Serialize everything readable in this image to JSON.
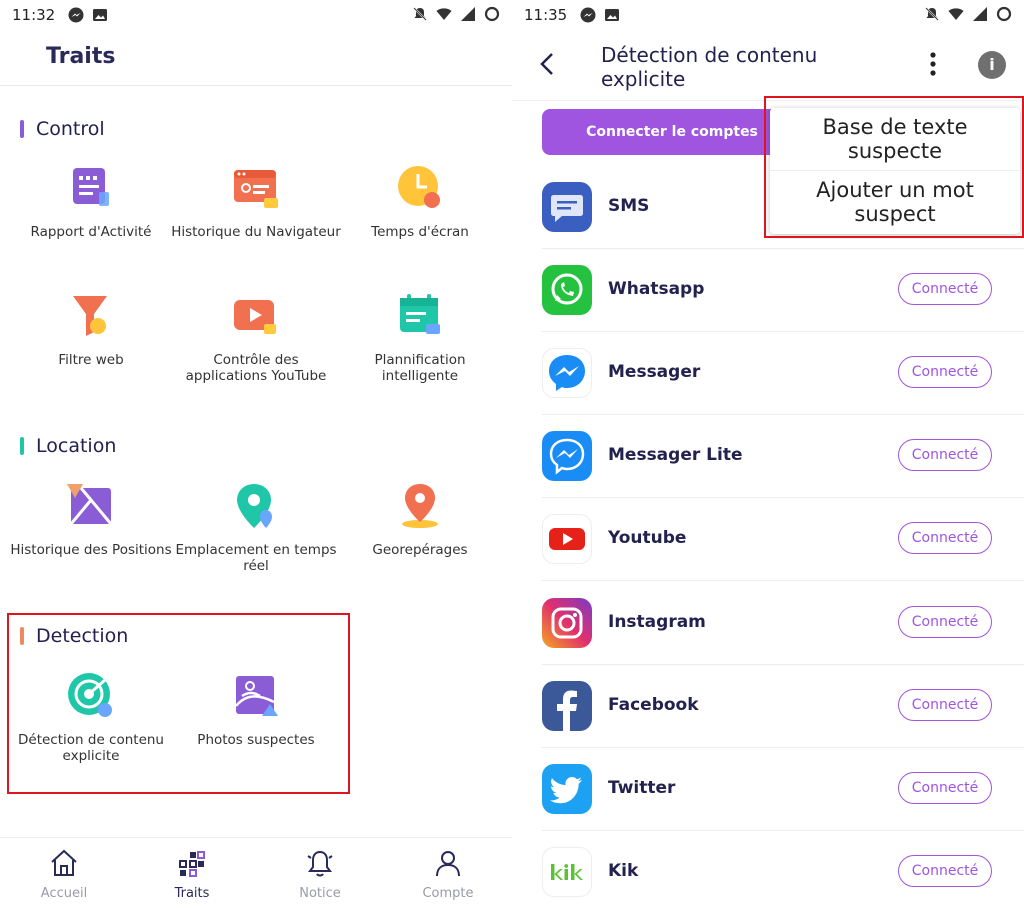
{
  "left": {
    "status_time": "11:32",
    "title": "Traits",
    "sections": [
      {
        "title": "Control",
        "color": "#8a5cd6"
      },
      {
        "title": "Location",
        "color": "#1fc7a8"
      },
      {
        "title": "Detection",
        "color": "#f08a5d"
      }
    ],
    "tiles": [
      {
        "label": "Rapport d'Activité",
        "icon": "activity-report-icon"
      },
      {
        "label": "Historique du Navigateur",
        "icon": "browser-history-icon"
      },
      {
        "label": "Temps d'écran",
        "icon": "screen-time-icon"
      },
      {
        "label": "Filtre web",
        "icon": "web-filter-icon"
      },
      {
        "label": "Contrôle des applications YouTube",
        "icon": "youtube-control-icon"
      },
      {
        "label": "Plannification intelligente",
        "icon": "smart-schedule-icon"
      },
      {
        "label": "Historique des Positions",
        "icon": "location-history-icon"
      },
      {
        "label": "Emplacement en temps réel",
        "icon": "realtime-location-icon"
      },
      {
        "label": "Georepérages",
        "icon": "geofence-icon"
      },
      {
        "label": "Détection de contenu explicite",
        "icon": "explicit-content-icon"
      },
      {
        "label": "Photos suspectes",
        "icon": "suspicious-photos-icon"
      }
    ],
    "nav": [
      {
        "label": "Accueil",
        "icon": "home-icon"
      },
      {
        "label": "Traits",
        "icon": "features-icon"
      },
      {
        "label": "Notice",
        "icon": "bell-icon"
      },
      {
        "label": "Compte",
        "icon": "account-icon"
      }
    ]
  },
  "right": {
    "status_time": "11:35",
    "title": "Détection de contenu explicite",
    "connect_all_label": "Connecter le comptes",
    "menu": [
      "Base de texte suspecte",
      "Ajouter un mot suspect"
    ],
    "apps": [
      {
        "name": "SMS",
        "icon": "sms-icon",
        "status": ""
      },
      {
        "name": "Whatsapp",
        "icon": "whatsapp-icon",
        "status": "Connecté"
      },
      {
        "name": "Messager",
        "icon": "messenger-icon",
        "status": "Connecté"
      },
      {
        "name": "Messager Lite",
        "icon": "messenger-lite-icon",
        "status": "Connecté"
      },
      {
        "name": "Youtube",
        "icon": "youtube-icon",
        "status": "Connecté"
      },
      {
        "name": "Instagram",
        "icon": "instagram-icon",
        "status": "Connecté"
      },
      {
        "name": "Facebook",
        "icon": "facebook-icon",
        "status": "Connecté"
      },
      {
        "name": "Twitter",
        "icon": "twitter-icon",
        "status": "Connecté"
      },
      {
        "name": "Kik",
        "icon": "kik-icon",
        "status": "Connecté"
      }
    ]
  },
  "colors": {
    "accent": "#9f55df",
    "highlight": "#e0141c",
    "title": "#23214e"
  }
}
